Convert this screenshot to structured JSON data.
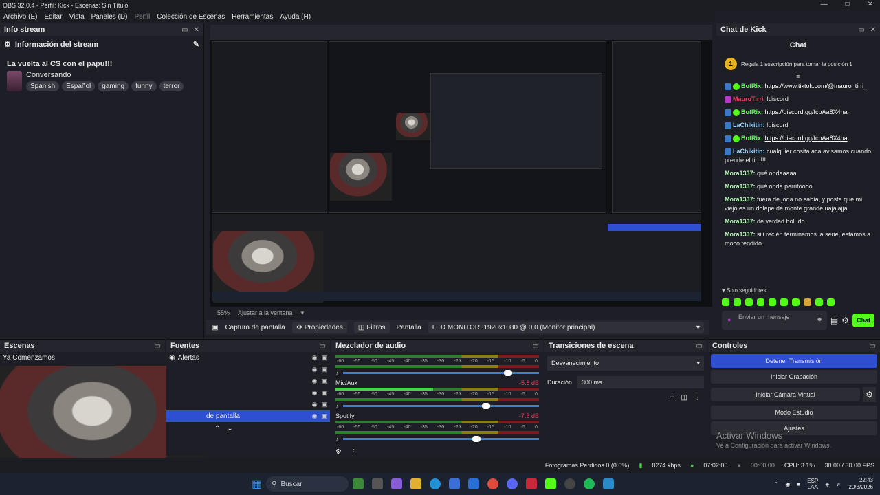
{
  "titlebar": {
    "title": "OBS 32.0.4 - Perfil: Kick - Escenas: Sin Título"
  },
  "menu": {
    "items": [
      "Archivo (E)",
      "Editar",
      "Vista",
      "Paneles (D)",
      "Perfil",
      "Colección de Escenas",
      "Herramientas",
      "Ayuda (H)"
    ]
  },
  "info_stream": {
    "dock_title": "Info stream",
    "subtitle": "Información del stream",
    "stream_title": "La vuelta al CS con el papu!!!",
    "category": "Conversando",
    "tags": [
      "Spanish",
      "Español",
      "gaming",
      "funny",
      "terror"
    ]
  },
  "preview_bar": {
    "zoom": "55%",
    "fit": "Ajustar a la ventana"
  },
  "source_bar": {
    "source_name": "Captura de pantalla",
    "properties": "Propiedades",
    "filters": "Filtros",
    "display_label": "Pantalla",
    "display_value": "LED MONITOR: 1920x1080 @ 0,0 (Monitor principal)"
  },
  "chat": {
    "dock_title": "Chat de Kick",
    "header": "Chat",
    "pinned_number": "1",
    "pinned_text": "Regala 1 suscripción para tomar la posición 1",
    "messages": [
      {
        "user": "BotRix:",
        "text": "https://www.tiktok.com/@mauro_tirri_",
        "link": true
      },
      {
        "user": "MauroTirri",
        "text": ": !discord",
        "link": false
      },
      {
        "user": "BotRix:",
        "text": "https://discord.gg/fcbAa8X4ha",
        "link": true
      },
      {
        "user": "LaChikitin:",
        "text": " !discord",
        "link": false
      },
      {
        "user": "BotRix:",
        "text": "https://discord.gg/fcbAa8X4ha",
        "link": true
      },
      {
        "user": "LaChikitin:",
        "text": " cualquier cosita aca avisamos cuando prende el tirri!!!",
        "link": false
      },
      {
        "user": "Mora1337:",
        "text": " qué ondaaaaa",
        "link": false
      },
      {
        "user": "Mora1337:",
        "text": " qué onda perritoooo",
        "link": false
      },
      {
        "user": "Mora1337:",
        "text": " fuera de joda no sabía, y posta que mi viejo es un dolape de monte grande uajajajja",
        "link": false
      },
      {
        "user": "Mora1337:",
        "text": " de verdad boludo",
        "link": false
      },
      {
        "user": "Mora1337:",
        "text": " siii recién terminamos la serie, estamos a moco tendido",
        "link": false
      }
    ],
    "followers_only": "Solo seguidores",
    "input_placeholder": "Enviar un mensaje",
    "send_label": "Chat"
  },
  "scenes": {
    "title": "Escenas",
    "items": [
      "Ya Comenzamos"
    ]
  },
  "sources": {
    "title": "Fuentes",
    "items": [
      "Alertas",
      "",
      "",
      "",
      "",
      "de pantalla"
    ]
  },
  "mixer": {
    "title": "Mezclador de audio",
    "scale": [
      "-60",
      "-55",
      "-50",
      "-45",
      "-40",
      "-35",
      "-30",
      "-25",
      "-20",
      "-15",
      "-10",
      "-5",
      "0"
    ],
    "channels": [
      {
        "name": "",
        "db": "",
        "fader": 0.82
      },
      {
        "name": "Mic/Aux",
        "db": "-5.5 dB",
        "fader": 0.71
      },
      {
        "name": "Spotify",
        "db": "-7.5 dB",
        "fader": 0.66
      }
    ]
  },
  "transitions": {
    "title": "Transiciones de escena",
    "selected": "Desvanecimiento",
    "duration_label": "Duración",
    "duration_value": "300 ms"
  },
  "controls": {
    "title": "Controles",
    "buttons": [
      "Detener Transmisión",
      "Iniciar Grabación",
      "Iniciar Cámara Virtual",
      "Modo Estudio",
      "Ajustes"
    ]
  },
  "watermark": {
    "line1": "Activar Windows",
    "line2": "Ve a Configuración para activar Windows."
  },
  "status": {
    "dropped": "Fotogramas Perdidos 0 (0.0%)",
    "bitrate": "8274 kbps",
    "live_time": "07:02:05",
    "rec_time": "00:00:00",
    "cpu": "CPU: 3.1%",
    "fps": "30.00 / 30.00 FPS"
  },
  "taskbar": {
    "search": "Buscar",
    "lang1": "ESP",
    "lang2": "LAA",
    "time": "22:43",
    "date": "20/3/2026"
  }
}
